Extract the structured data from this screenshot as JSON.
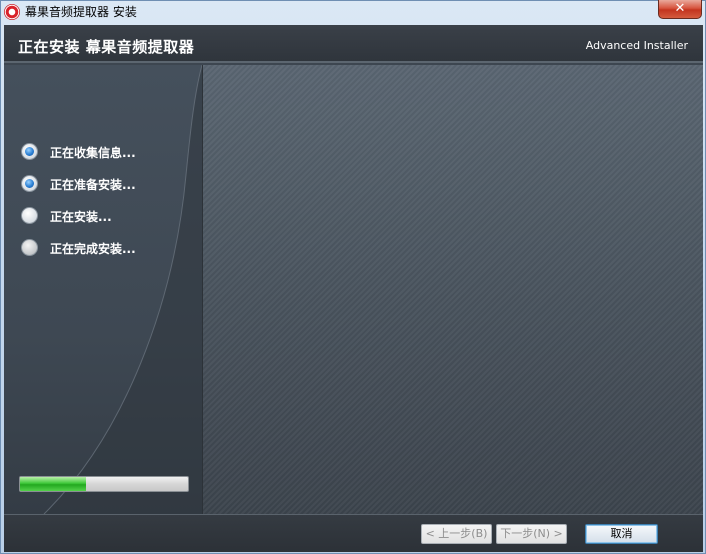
{
  "window": {
    "title": "幕果音频提取器 安装",
    "close_label": "✕"
  },
  "header": {
    "title": "正在安装 幕果音频提取器",
    "brand": "Advanced Installer"
  },
  "steps": [
    {
      "label": "正在收集信息...",
      "status": "done"
    },
    {
      "label": "正在准备安装...",
      "status": "done"
    },
    {
      "label": "正在安装...",
      "status": "current"
    },
    {
      "label": "正在完成安装...",
      "status": "pending"
    }
  ],
  "progress": {
    "fraction": 0.39
  },
  "buttons": {
    "back": "< 上一步(B)",
    "next": "下一步(N) >",
    "cancel": "取消"
  },
  "colors": {
    "progress_fill": "#2fb52c",
    "header_bg": "#31373e",
    "sidebar_bg": "#424c57"
  }
}
